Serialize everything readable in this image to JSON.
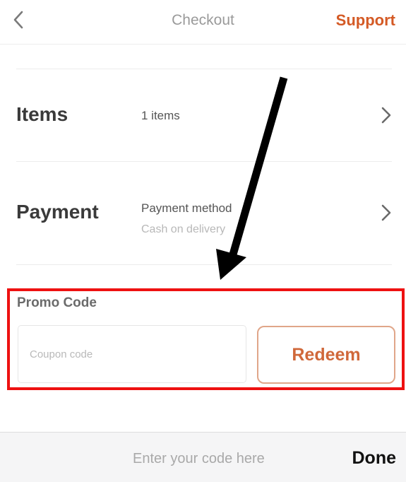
{
  "header": {
    "title": "Checkout",
    "support_label": "Support",
    "back_icon": "chevron-left-icon"
  },
  "items_row": {
    "label": "Items",
    "value": "1 items",
    "icon": "chevron-right-icon"
  },
  "payment_row": {
    "label": "Payment",
    "value": "Payment method",
    "sub_value": "Cash on delivery",
    "icon": "chevron-right-icon"
  },
  "promo": {
    "label": "Promo Code",
    "coupon_placeholder": "Coupon code",
    "coupon_value": "",
    "redeem_label": "Redeem"
  },
  "accessory_bar": {
    "hint": "Enter your code here",
    "done_label": "Done"
  },
  "colors": {
    "accent": "#d45a25",
    "highlight_box": "#ee1111",
    "arrow": "#000000"
  }
}
